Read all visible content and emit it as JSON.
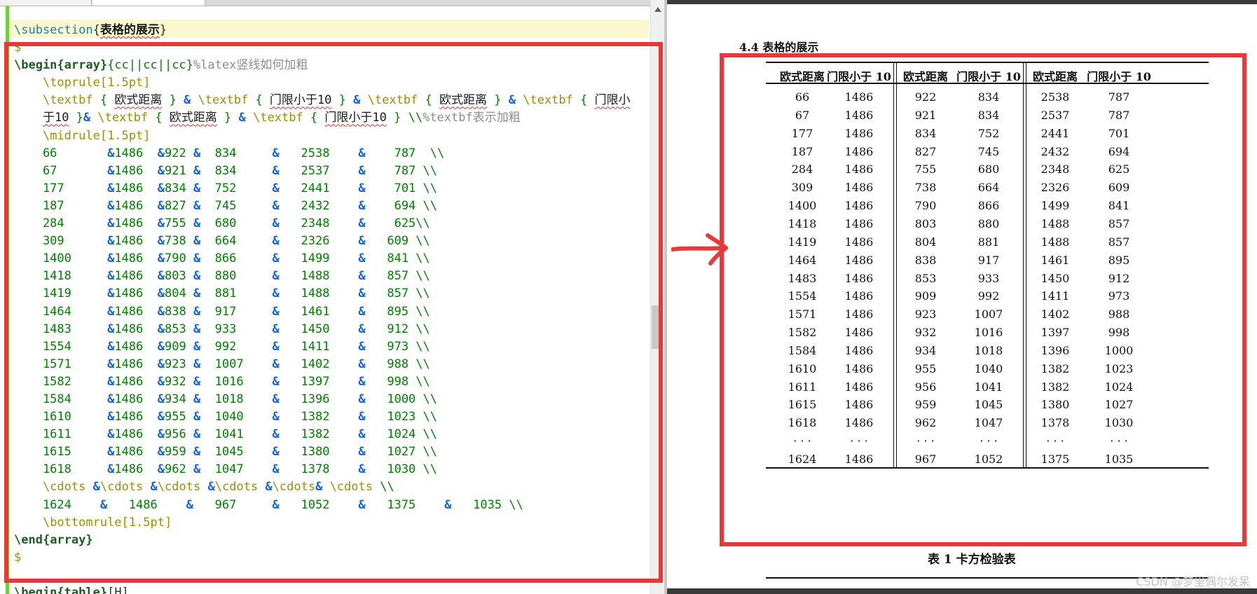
{
  "editor": {
    "lines": [
      {
        "kind": "subsection",
        "cmd": "\\subsection",
        "open": "{",
        "title": "表格的展示",
        "close": "}"
      },
      {
        "kind": "dollar",
        "text": "$"
      },
      {
        "kind": "begin",
        "cmd": "\\begin",
        "env": "{array}",
        "cols": "{cc||cc||cc}",
        "comment": "%latex竖线如何加粗"
      },
      {
        "kind": "cmd",
        "indent": "    ",
        "text": "\\toprule[1.5pt]"
      },
      {
        "kind": "header1",
        "indent": "    ",
        "text": "\\textbf { 欧式距离 } & \\textbf { 门限小于10 } & \\textbf { 欧式距离 } & \\textbf { 门限小"
      },
      {
        "kind": "header2",
        "indent": "    ",
        "text": "于10 }& \\textbf { 欧式距离 } & \\textbf { 门限小于10 } \\\\%textbf表示加粗"
      },
      {
        "kind": "cmd",
        "indent": "    ",
        "text": "\\midrule[1.5pt]"
      },
      {
        "kind": "row",
        "text": "    66       &1486  &922 &  834     &   2538    &    787  \\\\"
      },
      {
        "kind": "row",
        "text": "    67       &1486  &921 &  834     &   2537    &    787 \\\\"
      },
      {
        "kind": "row",
        "text": "    177      &1486  &834 &  752     &   2441    &    701 \\\\"
      },
      {
        "kind": "row",
        "text": "    187      &1486  &827 &  745     &   2432    &    694 \\\\"
      },
      {
        "kind": "row",
        "text": "    284      &1486  &755 &  680     &   2348    &    625\\\\"
      },
      {
        "kind": "row",
        "text": "    309      &1486  &738 &  664     &   2326    &   609 \\\\"
      },
      {
        "kind": "row",
        "text": "    1400     &1486  &790 &  866     &   1499    &   841 \\\\"
      },
      {
        "kind": "row",
        "text": "    1418     &1486  &803 &  880     &   1488    &   857 \\\\"
      },
      {
        "kind": "row",
        "text": "    1419     &1486  &804 &  881     &   1488    &   857 \\\\"
      },
      {
        "kind": "row",
        "text": "    1464     &1486  &838 &  917     &   1461    &   895 \\\\"
      },
      {
        "kind": "row",
        "text": "    1483     &1486  &853 &  933     &   1450    &   912 \\\\"
      },
      {
        "kind": "row",
        "text": "    1554     &1486  &909 &  992     &   1411    &   973 \\\\"
      },
      {
        "kind": "row",
        "text": "    1571     &1486  &923 &  1007    &   1402    &   988 \\\\"
      },
      {
        "kind": "row",
        "text": "    1582     &1486  &932 &  1016    &   1397    &   998 \\\\"
      },
      {
        "kind": "row",
        "text": "    1584     &1486  &934 &  1018    &   1396    &   1000 \\\\"
      },
      {
        "kind": "row",
        "text": "    1610     &1486  &955 &  1040    &   1382    &   1023 \\\\"
      },
      {
        "kind": "row",
        "text": "    1611     &1486  &956 &  1041    &   1382    &   1024 \\\\"
      },
      {
        "kind": "row",
        "text": "    1615     &1486  &959 &  1045    &   1380    &   1027 \\\\"
      },
      {
        "kind": "row",
        "text": "    1618     &1486  &962 &  1047    &   1378    &   1030 \\\\"
      },
      {
        "kind": "cmdrow",
        "text": "    \\cdots &\\cdots &\\cdots &\\cdots &\\cdots& \\cdots \\\\"
      },
      {
        "kind": "row",
        "text": "    1624    &   1486    &   967     &   1052    &   1375    &   1035 \\\\"
      },
      {
        "kind": "cmd",
        "indent": "    ",
        "text": "\\bottomrule[1.5pt]"
      },
      {
        "kind": "end",
        "cmd": "\\end",
        "env": "{array}"
      },
      {
        "kind": "dollar",
        "text": "$"
      },
      {
        "kind": "blank",
        "text": ""
      },
      {
        "kind": "begin2",
        "cmd": "\\begin",
        "env": "{table}",
        "opt": "[H]"
      }
    ]
  },
  "pdf": {
    "section_title": "4.4 表格的展示",
    "headers": [
      "欧式距离",
      "门限小于 10",
      "欧式距离",
      "门限小于 10",
      "欧式距离",
      "门限小于 10"
    ],
    "rows": [
      [
        "66",
        "1486",
        "922",
        "834",
        "2538",
        "787"
      ],
      [
        "67",
        "1486",
        "921",
        "834",
        "2537",
        "787"
      ],
      [
        "177",
        "1486",
        "834",
        "752",
        "2441",
        "701"
      ],
      [
        "187",
        "1486",
        "827",
        "745",
        "2432",
        "694"
      ],
      [
        "284",
        "1486",
        "755",
        "680",
        "2348",
        "625"
      ],
      [
        "309",
        "1486",
        "738",
        "664",
        "2326",
        "609"
      ],
      [
        "1400",
        "1486",
        "790",
        "866",
        "1499",
        "841"
      ],
      [
        "1418",
        "1486",
        "803",
        "880",
        "1488",
        "857"
      ],
      [
        "1419",
        "1486",
        "804",
        "881",
        "1488",
        "857"
      ],
      [
        "1464",
        "1486",
        "838",
        "917",
        "1461",
        "895"
      ],
      [
        "1483",
        "1486",
        "853",
        "933",
        "1450",
        "912"
      ],
      [
        "1554",
        "1486",
        "909",
        "992",
        "1411",
        "973"
      ],
      [
        "1571",
        "1486",
        "923",
        "1007",
        "1402",
        "988"
      ],
      [
        "1582",
        "1486",
        "932",
        "1016",
        "1397",
        "998"
      ],
      [
        "1584",
        "1486",
        "934",
        "1018",
        "1396",
        "1000"
      ],
      [
        "1610",
        "1486",
        "955",
        "1040",
        "1382",
        "1023"
      ],
      [
        "1611",
        "1486",
        "956",
        "1041",
        "1382",
        "1024"
      ],
      [
        "1615",
        "1486",
        "959",
        "1045",
        "1380",
        "1027"
      ],
      [
        "1618",
        "1486",
        "962",
        "1047",
        "1378",
        "1030"
      ],
      [
        "· · ·",
        "· · ·",
        "· · ·",
        "· · ·",
        "· · ·",
        "· · ·"
      ],
      [
        "1624",
        "1486",
        "967",
        "1052",
        "1375",
        "1035"
      ]
    ],
    "caption": "表 1    卡方检验表",
    "watermark": "CSDN @梦里偶尔发呆"
  },
  "annotation": {
    "color": "#e8393a",
    "arrow_icon": "right-arrow-icon"
  }
}
